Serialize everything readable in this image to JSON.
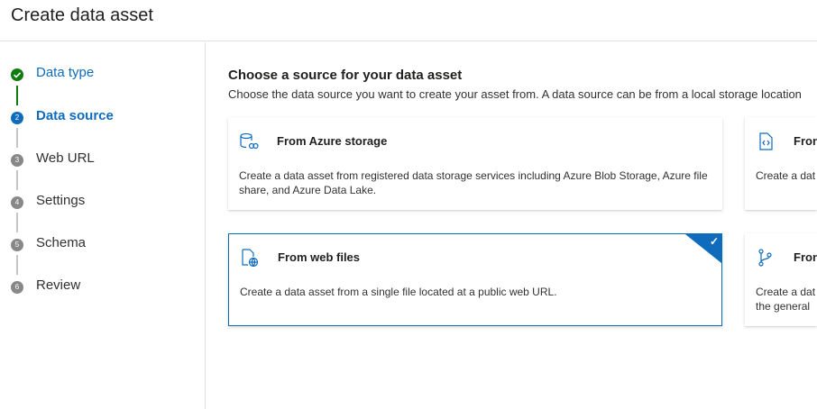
{
  "header": {
    "title": "Create data asset"
  },
  "steps": [
    {
      "label": "Data type",
      "number": "1",
      "status": "done"
    },
    {
      "label": "Data source",
      "number": "2",
      "status": "current"
    },
    {
      "label": "Web URL",
      "number": "3",
      "status": "pending"
    },
    {
      "label": "Settings",
      "number": "4",
      "status": "pending"
    },
    {
      "label": "Schema",
      "number": "5",
      "status": "pending"
    },
    {
      "label": "Review",
      "number": "6",
      "status": "pending"
    }
  ],
  "main": {
    "heading": "Choose a source for your data asset",
    "subheading": "Choose the data source you want to create your asset from. A data source can be from a local storage location"
  },
  "cards": [
    {
      "title": "From Azure storage",
      "description": "Create a data asset from registered data storage services including Azure Blob Storage, Azure file share, and Azure Data Lake.",
      "icon": "storage-icon",
      "selected": false
    },
    {
      "title": "Fron",
      "description": "Create a dat",
      "icon": "code-file-icon",
      "selected": false
    },
    {
      "title": "From web files",
      "description": "Create a data asset from a single file located at a public web URL.",
      "icon": "web-file-icon",
      "selected": true
    },
    {
      "title": "Fron",
      "description": "Create a dat the general",
      "icon": "branch-icon",
      "selected": false
    }
  ],
  "colors": {
    "accent": "#0f6cbd",
    "done": "#107c10",
    "pending": "#8a8886"
  }
}
